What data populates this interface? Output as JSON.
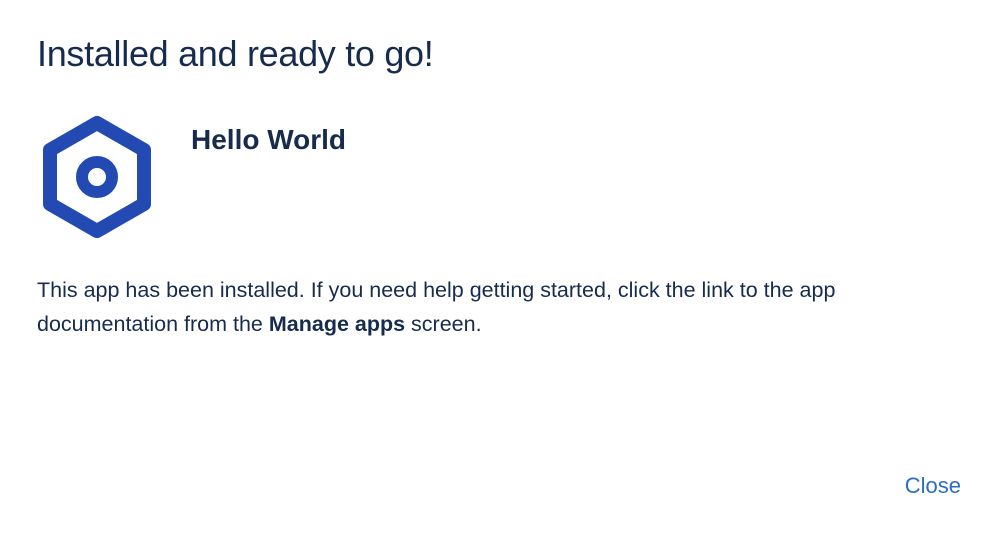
{
  "dialog": {
    "title": "Installed and ready to go!",
    "app": {
      "name": "Hello World",
      "icon": "hexagon-ring-icon",
      "icon_color": "#2349b2"
    },
    "description": {
      "before": "This app has been installed. If you need help getting started, click the link to the app documentation from the ",
      "emphasis": "Manage apps",
      "after": " screen."
    },
    "close_label": "Close",
    "colors": {
      "text": "#172b4d",
      "link": "#2b6fbf",
      "background": "#ffffff"
    }
  }
}
